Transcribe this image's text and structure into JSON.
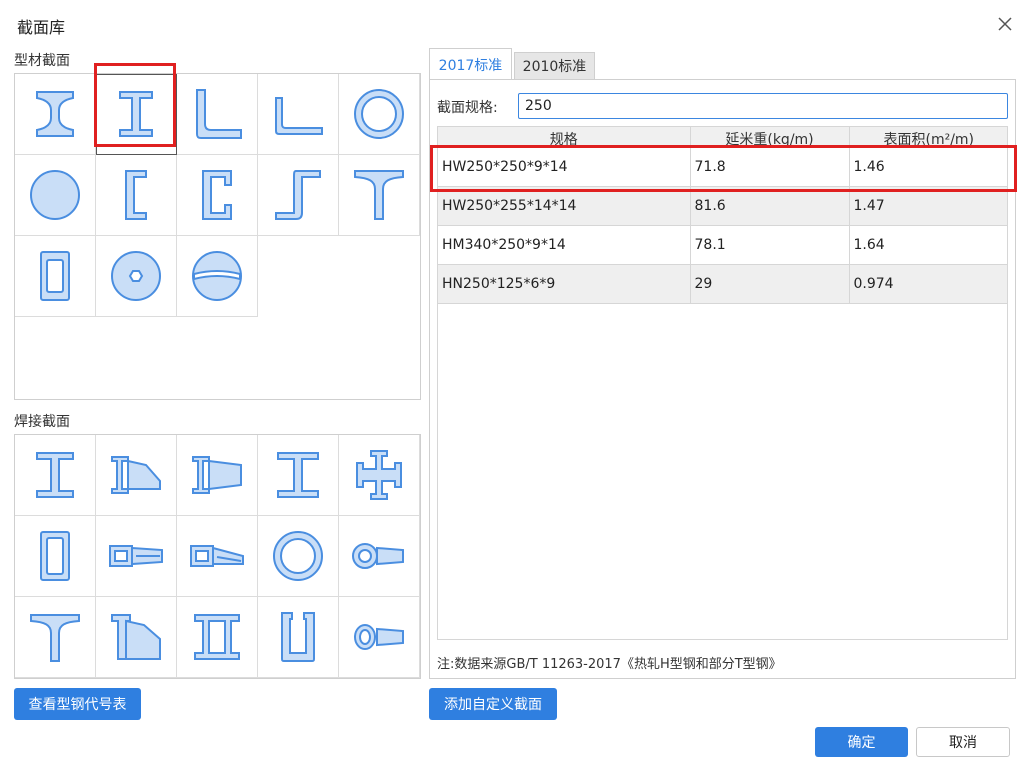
{
  "dialog": {
    "title": "截面库",
    "close_icon": "close-icon"
  },
  "rolled_section": {
    "label": "型材截面",
    "shapes": [
      "wide-flange-i-icon",
      "i-beam-icon",
      "angle-equal-icon",
      "angle-unequal-icon",
      "pipe-icon",
      "round-bar-icon",
      "channel-lipped-icon",
      "channel-icon",
      "z-section-icon",
      "t-section-icon",
      "rect-tube-icon",
      "hex-bar-icon",
      "split-circle-icon"
    ],
    "selected_index": 1
  },
  "welded_section": {
    "label": "焊接截面",
    "shapes": [
      "welded-i-icon",
      "welded-i-taper-icon",
      "welded-i-taper-both-icon",
      "welded-i-short-icon",
      "welded-cross-icon",
      "welded-box-icon",
      "box-taper-icon",
      "box-taper-2-icon",
      "welded-pipe-icon",
      "pipe-taper-icon",
      "welded-t-icon",
      "welded-t-taper-icon",
      "double-i-icon",
      "u-section-icon",
      "ellipse-taper-icon"
    ]
  },
  "buttons": {
    "view_codes": "查看型钢代号表",
    "add_custom": "添加自定义截面",
    "ok": "确定",
    "cancel": "取消"
  },
  "tabs": [
    {
      "label": "2017标准",
      "active": true
    },
    {
      "label": "2010标准",
      "active": false
    }
  ],
  "spec_filter": {
    "label": "截面规格:",
    "value": "250"
  },
  "table": {
    "headers": [
      "规格",
      "延米重(kg/m)",
      "表面积(m²/m)"
    ],
    "rows": [
      [
        "HW250*250*9*14",
        "71.8",
        "1.46"
      ],
      [
        "HW250*255*14*14",
        "81.6",
        "1.47"
      ],
      [
        "HM340*250*9*14",
        "78.1",
        "1.64"
      ],
      [
        "HN250*125*6*9",
        "29",
        "0.974"
      ]
    ],
    "highlighted_row": 0
  },
  "note": "注:数据来源GB/T 11263-2017《热轧H型钢和部分T型钢》",
  "colors": {
    "accent": "#2f7fe0",
    "highlight": "#e02020",
    "shape_fill": "#c9def7",
    "shape_stroke": "#4a8ee0"
  }
}
